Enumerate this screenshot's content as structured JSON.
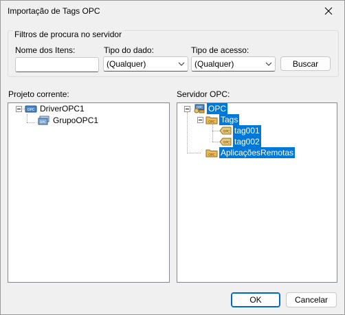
{
  "window": {
    "title": "Importação de Tags OPC",
    "close_icon": "close-icon"
  },
  "filters": {
    "group_label": "Filtros de procura no servidor",
    "item_name_label": "Nome dos Itens:",
    "item_name_value": "",
    "data_type_label": "Tipo do dado:",
    "data_type_value": "(Qualquer)",
    "access_type_label": "Tipo de acesso:",
    "access_type_value": "(Qualquer)",
    "search_button": "Buscar"
  },
  "current_project": {
    "label": "Projeto corrente:",
    "tree": [
      {
        "label": "DriverOPC1",
        "icon": "opc-driver-icon",
        "expanded": true
      },
      {
        "label": "GrupoOPC1",
        "icon": "opc-group-icon"
      }
    ]
  },
  "opc_server": {
    "label": "Servidor OPC:",
    "tree": [
      {
        "label": "OPC",
        "icon": "opc-server-icon",
        "selected": true,
        "expanded": true
      },
      {
        "label": "Tags",
        "icon": "opc-folder-icon",
        "selected": true,
        "expanded": true
      },
      {
        "label": "tag001",
        "icon": "opc-tag-icon",
        "selected": true
      },
      {
        "label": "tag002",
        "icon": "opc-tag-icon",
        "selected": true
      },
      {
        "label": "AplicaçõesRemotas",
        "icon": "opc-folder-icon",
        "selected": true
      }
    ]
  },
  "footer": {
    "ok_button": "OK",
    "cancel_button": "Cancelar"
  },
  "colors": {
    "selection": "#0078d7",
    "window_bg": "#f0f0f0",
    "default_button_border": "#0067c0"
  }
}
